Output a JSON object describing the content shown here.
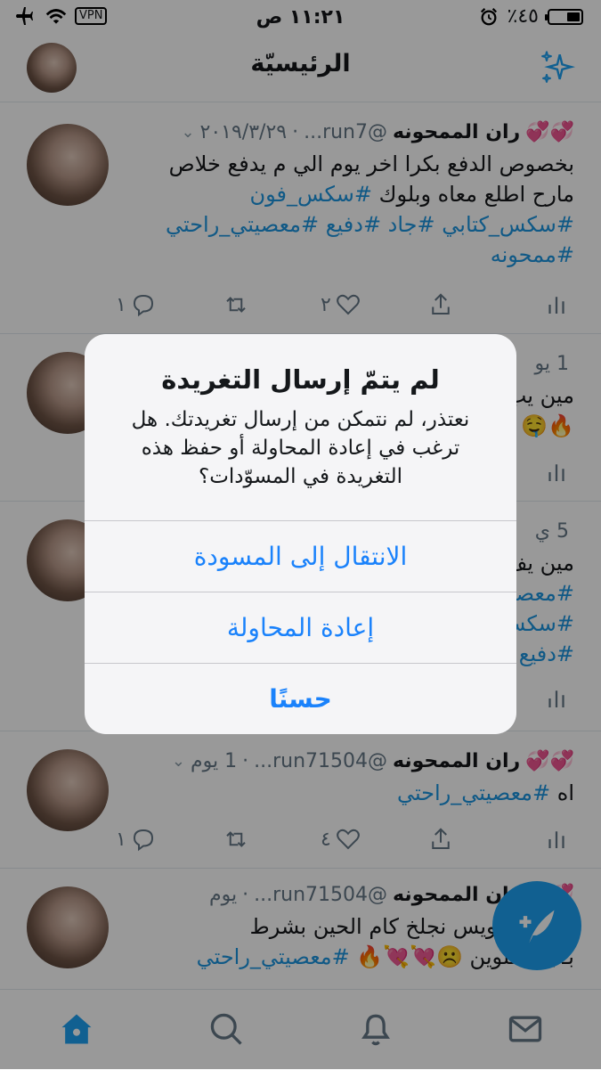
{
  "status_bar": {
    "battery_text": "٪٤٥",
    "time": "١١:٢١ ص",
    "vpn_label": "VPN",
    "battery_level": 0.45
  },
  "header": {
    "title": "الرئيسيّة"
  },
  "tweets": [
    {
      "name": "ران الممحونه",
      "emoji": "💞💞",
      "handle": "@run7...",
      "time": "٢٠١٩/٣/٢٩",
      "text_lines": [
        {
          "plain": "بخصوص الدفع بكرا اخر يوم الي م يدفع خلاص",
          "tags": ""
        },
        {
          "plain": "مارح اطلع معاه وبلوك ",
          "tags": "#سكس_فون"
        },
        {
          "plain": "",
          "tags": "#سكس_كتابي #جاد #دفيع #معصيتي_راحتي"
        },
        {
          "plain": "",
          "tags": "#ممحونه"
        }
      ],
      "replies": "١",
      "retweets": "",
      "likes": "٢"
    },
    {
      "name": "",
      "emoji": "",
      "handle": "",
      "time": "1 يو",
      "text_lines": [
        {
          "plain": "مين يب",
          "tags": ""
        },
        {
          "plain": "🔥🤤",
          "tags": ""
        }
      ],
      "replies": "",
      "retweets": "",
      "likes": ""
    },
    {
      "name": "",
      "emoji": "",
      "handle": "",
      "time": "5 ي",
      "text_lines": [
        {
          "plain": "مين يف",
          "tags": ""
        },
        {
          "plain": "",
          "tags": "#معصي"
        },
        {
          "plain": "",
          "tags": "#سكس"
        },
        {
          "plain": "",
          "tags": "#دفيع"
        }
      ],
      "replies": "",
      "retweets": "",
      "likes": ""
    },
    {
      "name": "ران الممحونه",
      "emoji": "💞💞",
      "handle": "@run71504...",
      "time": "1 يوم",
      "text_lines": [
        {
          "plain": "اه ",
          "tags": "#معصيتي_راحتي"
        }
      ],
      "replies": "١",
      "retweets": "",
      "likes": "٤"
    },
    {
      "name": "ران الممحونه",
      "emoji": "💞💞",
      "handle": "@run71504...",
      "time": "يوم",
      "text_lines": [
        {
          "plain": "ن يجي فويس نجلخ كام الحين بشرط",
          "tags": ""
        },
        {
          "plain": "بـ يلا يحلوين ☹️💘💘🔥 ",
          "tags": "#معصيتي_راحتي"
        }
      ],
      "replies": "",
      "retweets": "",
      "likes": ""
    }
  ],
  "dialog": {
    "title": "لم يتمّ إرسال التغريدة",
    "message": "نعتذر، لم نتمكن من إرسال تغريدتك. هل ترغب في إعادة المحاولة أو حفظ هذه التغريدة في المسوّدات؟",
    "go_to_drafts": "الانتقال إلى المسودة",
    "retry": "إعادة المحاولة",
    "ok": "حسنًا"
  },
  "tabs": [
    "home",
    "search",
    "notifications",
    "messages"
  ],
  "colors": {
    "accent": "#1da1f2",
    "hashtag": "#1b95e0",
    "dialog_button": "#1a82fb",
    "muted": "#657786"
  }
}
